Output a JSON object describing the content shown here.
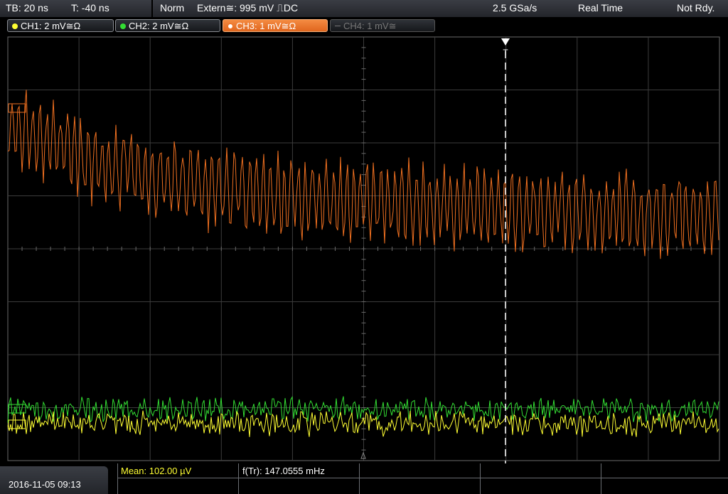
{
  "top_bar": {
    "timebase": "TB: 20 ns",
    "trigger_time": "T: -40 ns",
    "trigger_mode": "Norm",
    "trigger_source": "Extern≅: 995 mV ⎍DC",
    "sample_rate": "2.5 GSa/s",
    "acq_mode": "Real Time",
    "status": "Not Rdy."
  },
  "channels": [
    {
      "label": "CH1: 2 mV≅Ω",
      "color": "#ffff33",
      "state": "on"
    },
    {
      "label": "CH2: 2 mV≅Ω",
      "color": "#33dd33",
      "state": "on"
    },
    {
      "label": "CH3: 1 mV≅Ω",
      "color": "#f07020",
      "state": "active"
    },
    {
      "label": "CH4: 1 mV≅",
      "color": "#777777",
      "state": "off"
    }
  ],
  "trigger_marker": "T",
  "measurements": {
    "mean": "Mean: 102.00 µV",
    "frequency": "f(Tr): 147.0555 mHz"
  },
  "datetime": "2016-11-05 09:13",
  "colors": {
    "ch1": "#ffff33",
    "ch2": "#33dd33",
    "ch3": "#f07020",
    "grid": "#4a4a4a"
  }
}
